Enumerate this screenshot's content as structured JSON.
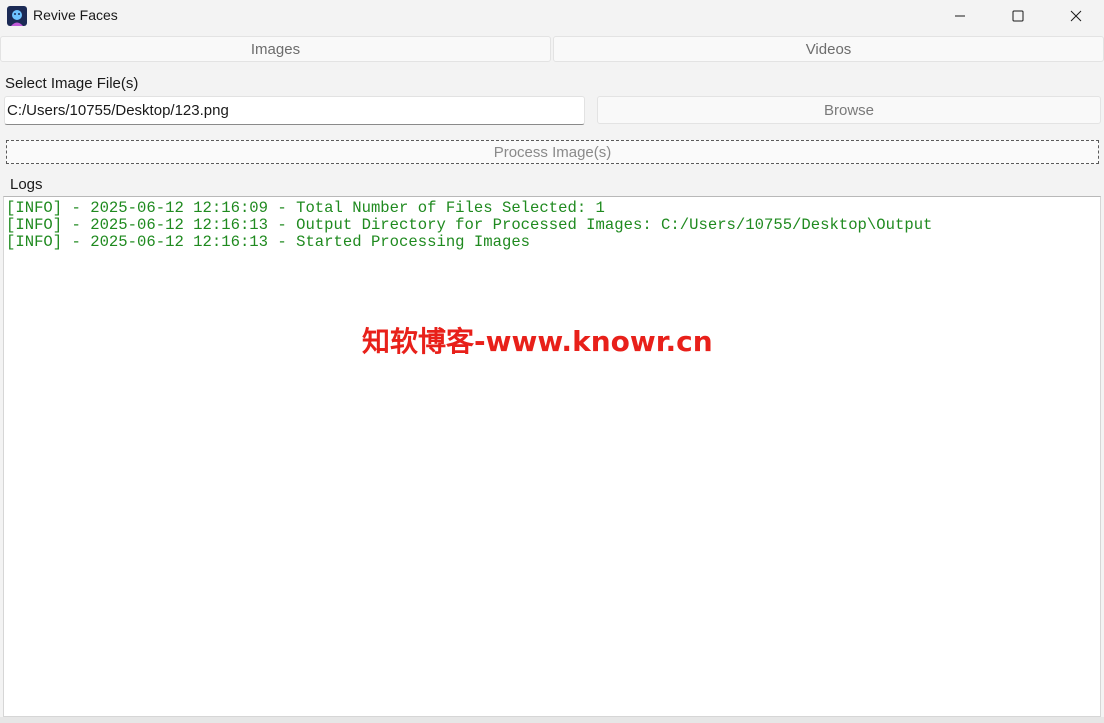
{
  "window": {
    "title": "Revive Faces",
    "icon": "revive-faces-app-icon"
  },
  "tabs": [
    {
      "label": "Images"
    },
    {
      "label": "Videos"
    }
  ],
  "image_form": {
    "select_label": "Select Image File(s)",
    "file_path_value": "C:/Users/10755/Desktop/123.png",
    "browse_label": "Browse",
    "process_label": "Process Image(s)"
  },
  "logs": {
    "label": "Logs",
    "lines": [
      "[INFO] - 2025-06-12 12:16:09 - Total Number of Files Selected: 1",
      "[INFO] - 2025-06-12 12:16:13 - Output Directory for Processed Images: C:/Users/10755/Desktop\\Output",
      "[INFO] - 2025-06-12 12:16:13 - Started Processing Images"
    ],
    "text_color": "#1f8a1f"
  },
  "watermark": {
    "text": "知软博客-www.knowr.cn",
    "color": "#e8201a"
  }
}
